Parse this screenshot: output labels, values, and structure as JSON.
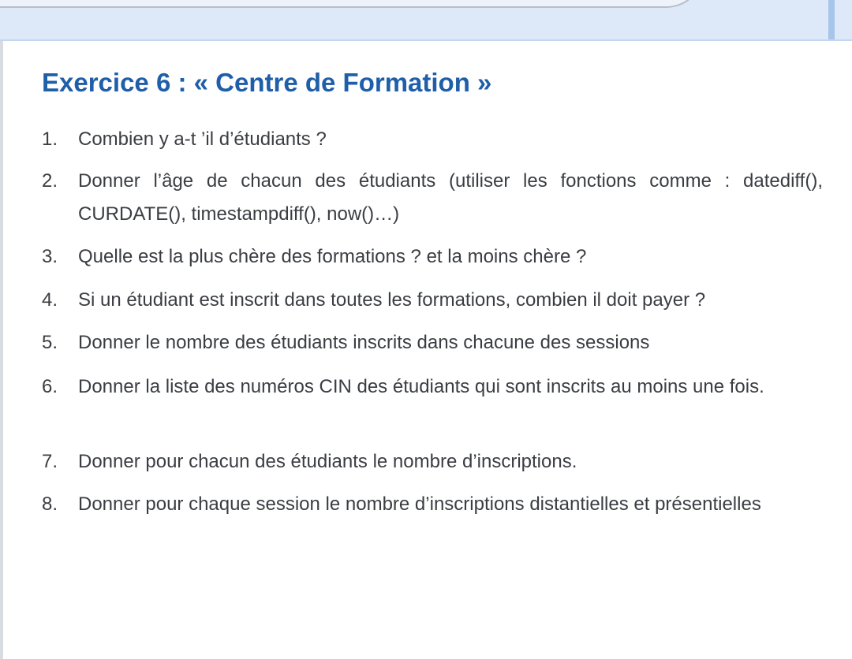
{
  "exercise": {
    "title": "Exercice 6 : « Centre de Formation »"
  },
  "questions": [
    {
      "number": "1.",
      "text": "Combien y a-t ’il d’étudiants ?"
    },
    {
      "number": "2.",
      "text": "Donner l’âge de chacun des étudiants (utiliser les fonctions comme : datediff(), CURDATE(), timestampdiff(), now()…)"
    },
    {
      "number": "3.",
      "text": "Quelle est la plus chère des formations ? et la moins chère ?"
    },
    {
      "number": "4.",
      "text": "Si un étudiant est inscrit dans toutes les formations, combien il doit payer ?"
    },
    {
      "number": "5.",
      "text": "Donner le nombre des étudiants inscrits dans chacune des sessions"
    },
    {
      "number": "6.",
      "text": "Donner la liste des numéros CIN des étudiants qui sont inscrits au moins une fois."
    },
    {
      "number": "7.",
      "text": "Donner pour chacun des étudiants le nombre d’inscriptions."
    },
    {
      "number": "8.",
      "text": "Donner pour chaque session le nombre d’inscriptions distantielles et présentielles"
    }
  ]
}
